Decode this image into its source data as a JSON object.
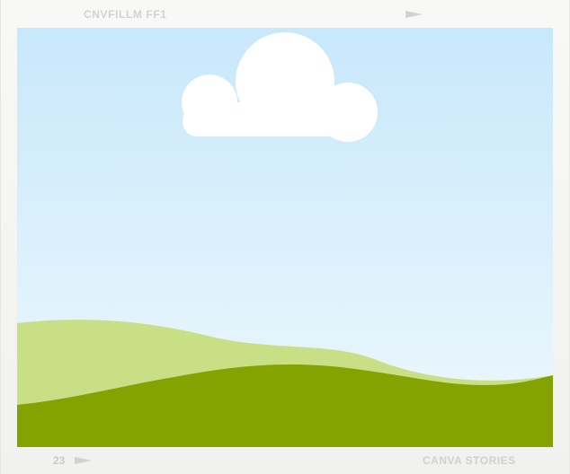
{
  "frame": {
    "top_label": "CNVFILLM FF1",
    "bottom_left_number": "23",
    "bottom_right_label": "CANVA STORIES"
  },
  "icons": {
    "top_arrow": "play-arrow-icon",
    "bottom_arrow": "play-arrow-icon"
  },
  "colors": {
    "sky_top": "#c8e8fb",
    "sky_bottom": "#eef8fc",
    "cloud": "#ffffff",
    "hill_light": "#c9df86",
    "hill_dark": "#85a300",
    "frame": "#f4f4f2"
  }
}
